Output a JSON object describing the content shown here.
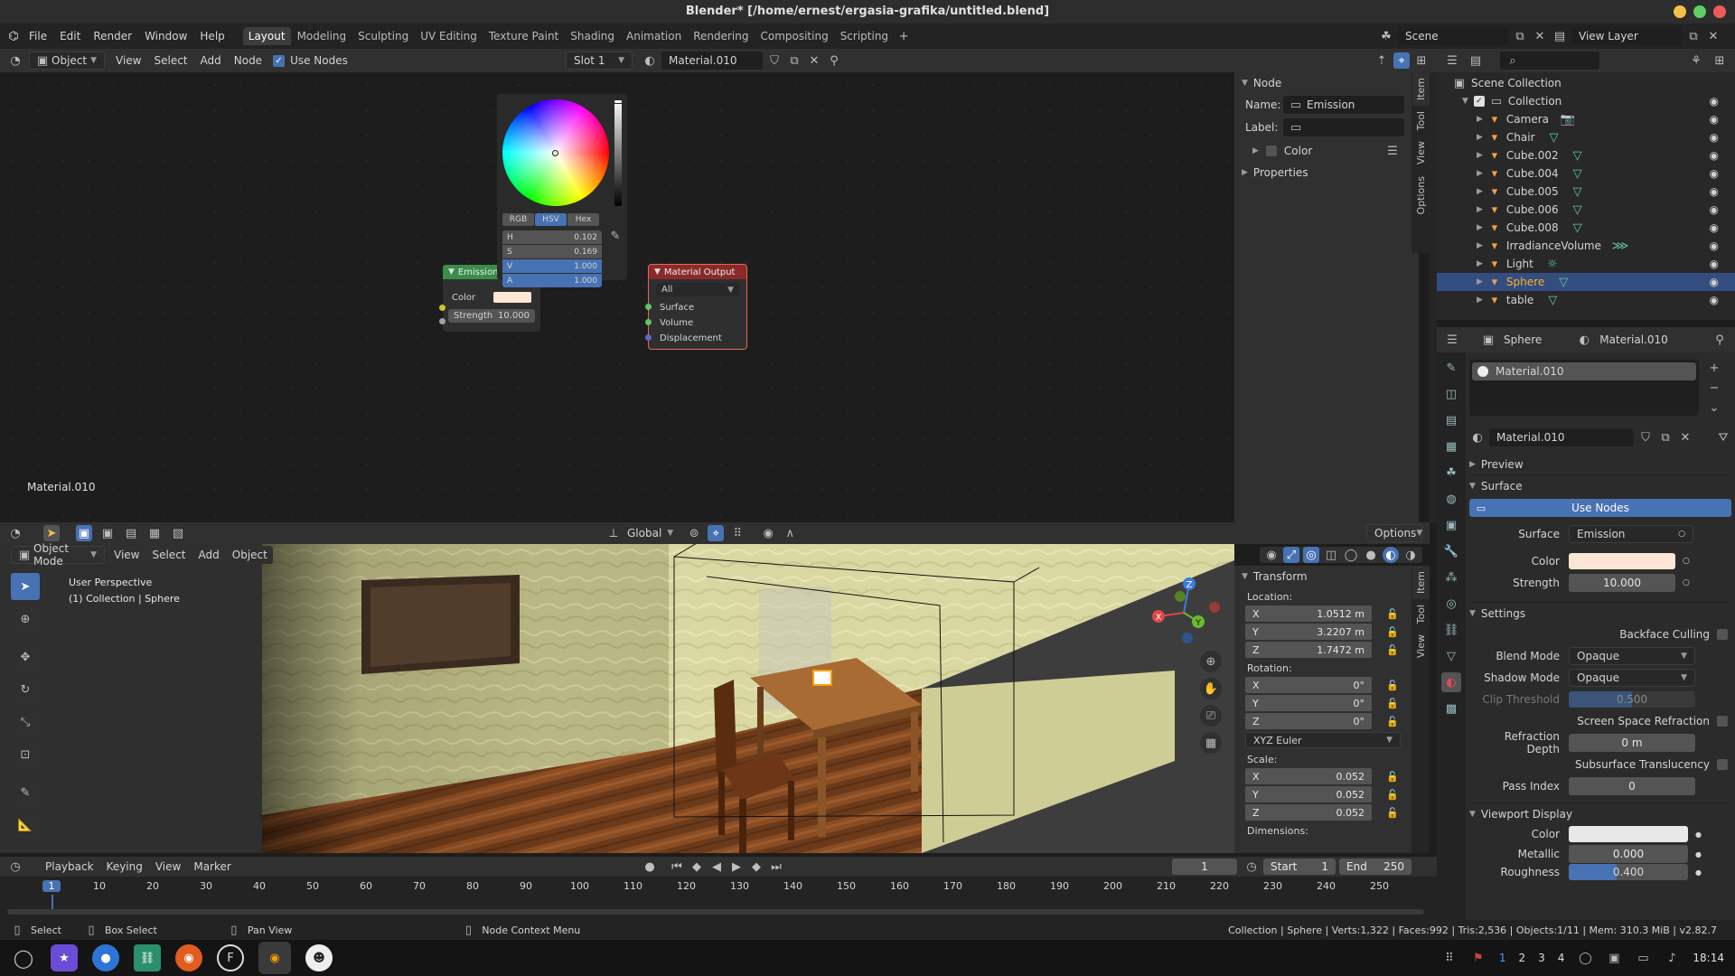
{
  "title_bar": {
    "title": "Blender* [/home/ernest/ergasia-grafika/untitled.blend]"
  },
  "menu": [
    "File",
    "Edit",
    "Render",
    "Window",
    "Help"
  ],
  "workspaces": [
    "Layout",
    "Modeling",
    "Sculpting",
    "UV Editing",
    "Texture Paint",
    "Shading",
    "Animation",
    "Rendering",
    "Compositing",
    "Scripting"
  ],
  "scene": {
    "scene_label": "Scene",
    "view_layer_label": "View Layer"
  },
  "node_header": {
    "mode": "Object",
    "menus": [
      "View",
      "Select",
      "Add",
      "Node"
    ],
    "use_nodes": "Use Nodes",
    "slot": "Slot 1",
    "material": "Material.010"
  },
  "node_editor": {
    "material_label": "Material.010",
    "color_picker": {
      "modes": [
        "RGB",
        "HSV",
        "Hex"
      ],
      "active_mode": "HSV",
      "h_label": "H",
      "h": "0.102",
      "s_label": "S",
      "s": "0.169",
      "v_label": "V",
      "v": "1.000",
      "a_label": "A",
      "a": "1.000",
      "v_level": 1.0,
      "a_level": 1.0
    },
    "emission_node": {
      "title": "Emission",
      "color_label": "Color",
      "strength_label": "Strength",
      "strength": "10.000",
      "color": "#fde7d4"
    },
    "output_node": {
      "title": "Material Output",
      "target": "All",
      "sockets": [
        "Surface",
        "Volume",
        "Displacement"
      ]
    }
  },
  "node_sidebar": {
    "section": "Node",
    "name_label": "Name:",
    "name": "Emission",
    "label_label": "Label:",
    "color_label": "Color",
    "properties_label": "Properties",
    "tabs": [
      "Item",
      "Tool",
      "View",
      "Options"
    ]
  },
  "outliner": {
    "root": "Scene Collection",
    "collection": "Collection",
    "items": [
      {
        "name": "Camera",
        "icon": "camera-icon",
        "selected": false
      },
      {
        "name": "Chair",
        "icon": "mesh-icon",
        "selected": false
      },
      {
        "name": "Cube.002",
        "icon": "mesh-icon",
        "selected": false
      },
      {
        "name": "Cube.004",
        "icon": "mesh-icon",
        "selected": false
      },
      {
        "name": "Cube.005",
        "icon": "mesh-icon",
        "selected": false
      },
      {
        "name": "Cube.006",
        "icon": "mesh-icon",
        "selected": false
      },
      {
        "name": "Cube.008",
        "icon": "mesh-icon",
        "selected": false
      },
      {
        "name": "IrradianceVolume",
        "icon": "probe-icon",
        "selected": false
      },
      {
        "name": "Light",
        "icon": "light-icon",
        "selected": false
      },
      {
        "name": "Sphere",
        "icon": "mesh-icon",
        "selected": true
      },
      {
        "name": "table",
        "icon": "mesh-icon",
        "selected": false
      }
    ]
  },
  "properties": {
    "object": "Sphere",
    "material": "Material.010",
    "slot": "Material.010",
    "material_field": "Material.010",
    "preview": "Preview",
    "surface_section": "Surface",
    "use_nodes": "Use Nodes",
    "surface_label": "Surface",
    "surface_value": "Emission",
    "color_label": "Color",
    "strength_label": "Strength",
    "strength": "10.000",
    "settings_section": "Settings",
    "backface_culling": "Backface Culling",
    "blend_mode_label": "Blend Mode",
    "blend_mode": "Opaque",
    "shadow_mode_label": "Shadow Mode",
    "shadow_mode": "Opaque",
    "clip_threshold_label": "Clip Threshold",
    "clip_threshold": "0.500",
    "ssr_label": "Screen Space Refraction",
    "refraction_depth_label": "Refraction Depth",
    "refraction_depth": "0 m",
    "sss_label": "Subsurface Translucency",
    "pass_index_label": "Pass Index",
    "pass_index": "0",
    "viewport_display": "Viewport Display",
    "vd_color_label": "Color",
    "metallic_label": "Metallic",
    "metallic": "0.000",
    "roughness_label": "Roughness",
    "roughness": "0.400",
    "clip_threshold_level": 0.5,
    "roughness_level": 0.4
  },
  "viewport_header": {
    "mode": "Object Mode",
    "menus": [
      "View",
      "Select",
      "Add",
      "Object"
    ],
    "orientation": "Global",
    "options": "Options"
  },
  "viewport": {
    "perspective": "User Perspective",
    "context": "(1) Collection | Sphere"
  },
  "transform": {
    "title": "Transform",
    "location_label": "Location:",
    "location": [
      {
        "axis": "X",
        "value": "1.0512 m"
      },
      {
        "axis": "Y",
        "value": "3.2207 m"
      },
      {
        "axis": "Z",
        "value": "1.7472 m"
      }
    ],
    "rotation_label": "Rotation:",
    "rotation": [
      {
        "axis": "X",
        "value": "0°"
      },
      {
        "axis": "Y",
        "value": "0°"
      },
      {
        "axis": "Z",
        "value": "0°"
      }
    ],
    "euler": "XYZ Euler",
    "scale_label": "Scale:",
    "scale": [
      {
        "axis": "X",
        "value": "0.052"
      },
      {
        "axis": "Y",
        "value": "0.052"
      },
      {
        "axis": "Z",
        "value": "0.052"
      }
    ],
    "dimensions_label": "Dimensions:",
    "tabs": [
      "Item",
      "Tool",
      "View"
    ]
  },
  "timeline": {
    "menus": [
      "Playback",
      "Keying",
      "View",
      "Marker"
    ],
    "current_frame": "1",
    "start_label": "Start",
    "start": "1",
    "end_label": "End",
    "end": "250",
    "ticks": [
      "1",
      "10",
      "20",
      "30",
      "40",
      "50",
      "60",
      "70",
      "80",
      "90",
      "100",
      "110",
      "120",
      "130",
      "140",
      "150",
      "160",
      "170",
      "180",
      "190",
      "200",
      "210",
      "220",
      "230",
      "240",
      "250"
    ]
  },
  "status_bar": {
    "select": "Select",
    "box_select": "Box Select",
    "pan_view": "Pan View",
    "context_menu": "Node Context Menu",
    "stats": "Collection | Sphere | Verts:1,322 | Faces:992 | Tris:2,536 | Objects:1/11 | Mem: 310.3 MiB | v2.82.7"
  },
  "taskbar": {
    "workspaces": [
      "1",
      "2",
      "3",
      "4"
    ],
    "clock": "18:14"
  }
}
